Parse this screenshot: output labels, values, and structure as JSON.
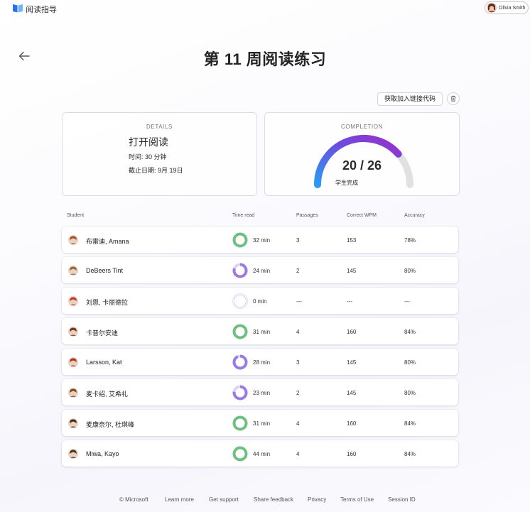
{
  "app": {
    "title": "阅读指导",
    "user_name": "Olivia Smith",
    "accent_color": "#8b3fd9"
  },
  "page": {
    "title_bold": "第 11 周",
    "title_rest": "阅读练习"
  },
  "toolbar": {
    "join_label": "获取加入链接代码"
  },
  "details": {
    "label": "DETAILS",
    "type": "打开阅读",
    "time": "时间: 30 分钟",
    "due": "截止日期: 9月 19日"
  },
  "completion": {
    "label": "COMPLETION",
    "value": "20 / 26",
    "completed": 20,
    "total": 26,
    "subtitle": "学生完成"
  },
  "table": {
    "headers": {
      "student": "Student",
      "time": "Time read",
      "passages": "Passages",
      "wpm": "Correct WPM",
      "accuracy": "Accuracy"
    },
    "rows": [
      {
        "name": "布雷迪, Amana",
        "time": "32 min",
        "passages": "3",
        "wpm": "153",
        "accuracy": "78%",
        "progress": 1.0,
        "avatar_color": "#a0522d"
      },
      {
        "name": "DeBeers Tint",
        "time": "24 min",
        "passages": "2",
        "wpm": "145",
        "accuracy": "80%",
        "progress": 0.8,
        "avatar_color": "#8b6b3d"
      },
      {
        "name": "刘恩, 卡丽德拉",
        "time": "0 min",
        "passages": "---",
        "wpm": "---",
        "accuracy": "---",
        "progress": 0,
        "avatar_color": "#c0392b"
      },
      {
        "name": "卡普尔安迪",
        "time": "31 min",
        "passages": "4",
        "wpm": "160",
        "accuracy": "84%",
        "progress": 1.0,
        "avatar_color": "#6b3a1f"
      },
      {
        "name": "Larsson, Kat",
        "time": "28 min",
        "passages": "3",
        "wpm": "145",
        "accuracy": "80%",
        "progress": 0.93,
        "avatar_color": "#b03030"
      },
      {
        "name": "麦卡绍, 艾希礼",
        "time": "23 min",
        "passages": "2",
        "wpm": "145",
        "accuracy": "80%",
        "progress": 0.77,
        "avatar_color": "#7a4b2a"
      },
      {
        "name": "麦康奈尔, 杜琪峰",
        "time": "31 min",
        "passages": "4",
        "wpm": "160",
        "accuracy": "84%",
        "progress": 1.0,
        "avatar_color": "#3d2b1f"
      },
      {
        "name": "Miwa, Kayo",
        "time": "44 min",
        "passages": "4",
        "wpm": "160",
        "accuracy": "84%",
        "progress": 1.0,
        "avatar_color": "#4a3426"
      }
    ]
  },
  "footer": {
    "copyright": "© Microsoft",
    "learn_more": "Learn more",
    "support": "Get support",
    "feedback": "Share feedback",
    "privacy": "Privacy",
    "terms": "Terms of Use",
    "session": "Session ID"
  }
}
